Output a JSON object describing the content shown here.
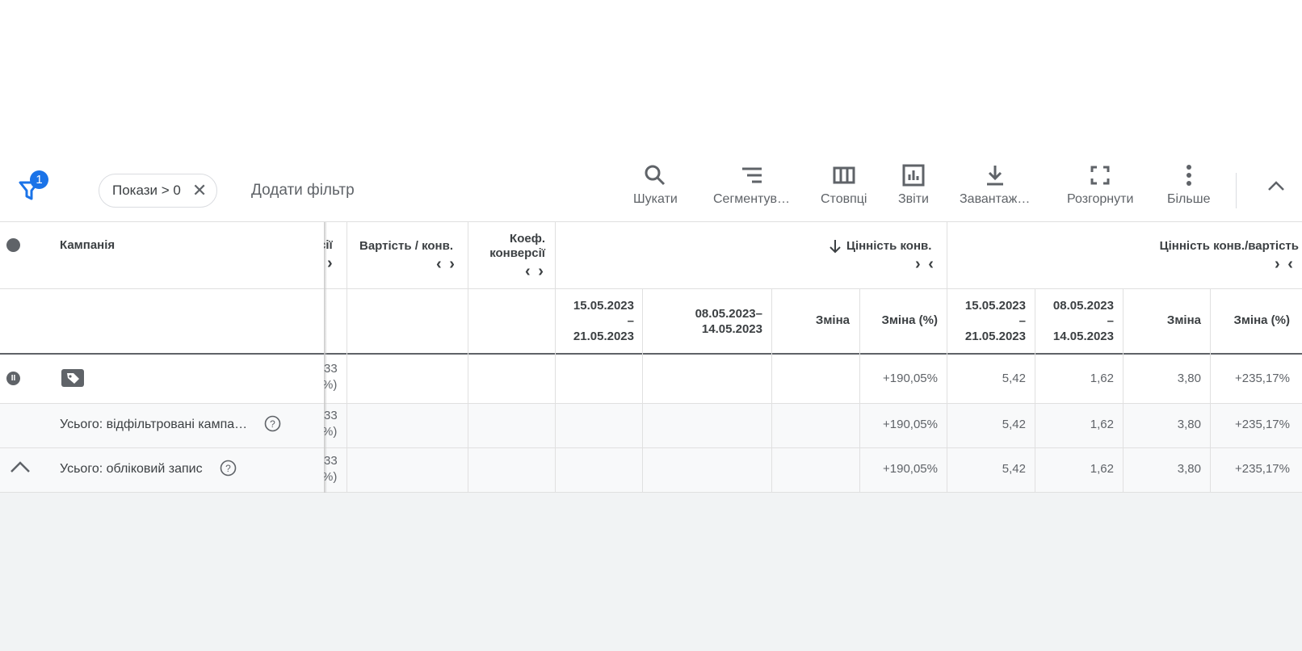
{
  "toolbar": {
    "filter_badge": "1",
    "chip_label": "Покази > 0",
    "chip_close": "✕",
    "add_filter": "Додати фільтр",
    "tools": [
      "Шукати",
      "Сегментув…",
      "Стовпці",
      "Звіти",
      "Завантаж…",
      "Розгорнути",
      "Більше"
    ]
  },
  "table": {
    "header": {
      "campaign": "Кампанія",
      "clipped_col_top": "сії",
      "clipped_col_arrow": "›",
      "cost_per_conv": "Вартість / конв.",
      "conv_rate_line1": "Коеф.",
      "conv_rate_line2": "конверсії",
      "expand_arrows": "‹ ›",
      "collapse_arrows": "› ‹",
      "conv_value": "Цінність конв.",
      "conv_value_cost": "Цінність конв./вартість"
    },
    "subheader": {
      "period1_a": "15.05.2023",
      "period1_dash": "–",
      "period1_b": "21.05.2023",
      "period2_a": "08.05.2023–",
      "period2_b": "14.05.2023",
      "change": "Зміна",
      "change_pct": "Зміна (%)",
      "period3_a": "15.05.2023",
      "period3_dash": "–",
      "period3_b": "21.05.2023",
      "period4_a": "08.05.2023",
      "period4_dash": "–",
      "period4_b": "14.05.2023",
      "change2": "Зміна",
      "change_pct2": "Зміна (%)"
    },
    "rows": [
      {
        "label": "",
        "clip_a": "33",
        "clip_b": "%)",
        "conv_change_pct": "+190,05%",
        "v1": "5,42",
        "v2": "1,62",
        "v3": "3,80",
        "v4": "+235,17%"
      },
      {
        "label": "Усього: відфільтровані кампа…",
        "clip_a": "33",
        "clip_b": "%)",
        "conv_change_pct": "+190,05%",
        "v1": "5,42",
        "v2": "1,62",
        "v3": "3,80",
        "v4": "+235,17%"
      },
      {
        "label": "Усього: обліковий запис",
        "clip_a": "33",
        "clip_b": "%)",
        "conv_change_pct": "+190,05%",
        "v1": "5,42",
        "v2": "1,62",
        "v3": "3,80",
        "v4": "+235,17%"
      }
    ]
  },
  "colors": {
    "accent": "#1a73e8",
    "icon": "#5f6368",
    "row_shade": "#f8f9fa",
    "footer_bg": "#f1f3f4"
  }
}
